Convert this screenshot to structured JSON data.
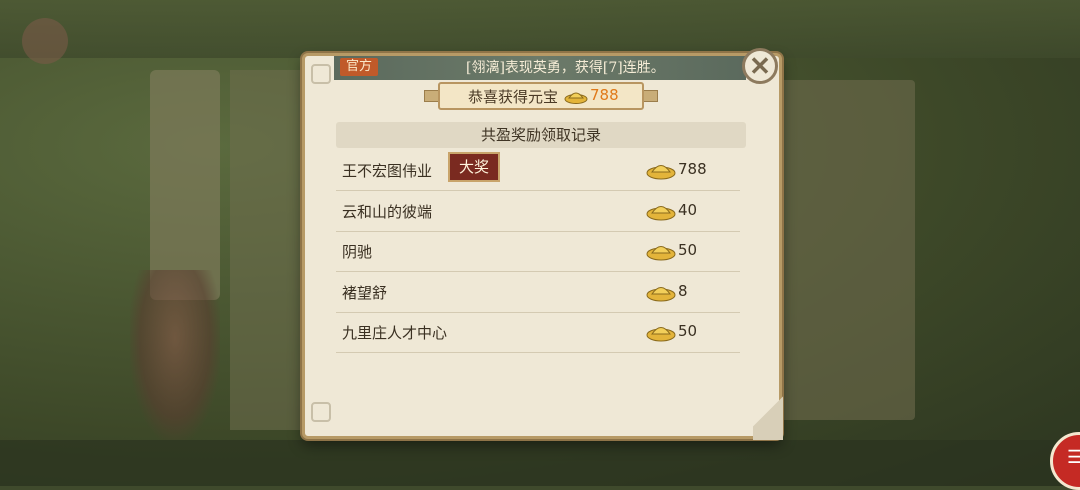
{
  "ticker": {
    "tag": "官方",
    "message": "[翎漓]表现英勇，获得[7]连胜。"
  },
  "banner": {
    "title": "恭喜获得元宝",
    "amount": "788",
    "icon": "gold-ingot-icon"
  },
  "subheading": "共盈奖励领取记录",
  "records": [
    {
      "name": "王不宏图伟业",
      "badge": "大奖",
      "amount": "788"
    },
    {
      "name": "云和山的彼端",
      "badge": "",
      "amount": "40"
    },
    {
      "name": "阴驰",
      "badge": "",
      "amount": "50"
    },
    {
      "name": "褚望舒",
      "badge": "",
      "amount": "8"
    },
    {
      "name": "九里庄人才中心",
      "badge": "",
      "amount": "50"
    }
  ],
  "colors": {
    "accent_orange": "#e07a1a",
    "badge_red": "#7a2a20",
    "parchment": "#efe8d6"
  }
}
